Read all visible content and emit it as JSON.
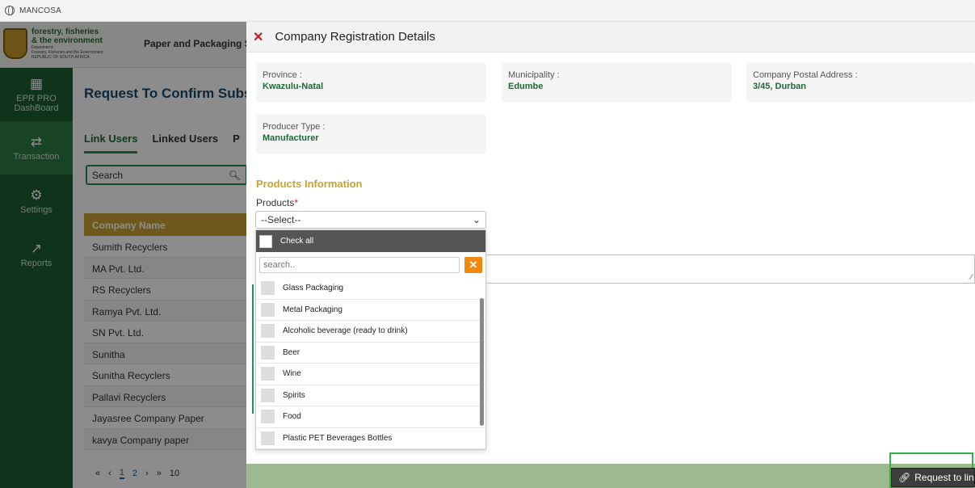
{
  "browser": {
    "title": "MANCOSA"
  },
  "app": {
    "logo_line1": "forestry, fisheries",
    "logo_line2": "& the environment",
    "logo_small1": "Department:",
    "logo_small2": "Forestry, Fisheries and the Environment",
    "logo_small3": "REPUBLIC OF SOUTH AFRICA",
    "header_title": "Paper and Packaging Sec",
    "page_title": "Request To Confirm Subscr",
    "nav": [
      {
        "label": "EPR PRO DashBoard",
        "icon": "dashboard-icon"
      },
      {
        "label": "Transaction",
        "icon": "transaction-icon"
      },
      {
        "label": "Settings",
        "icon": "settings-icon"
      },
      {
        "label": "Reports",
        "icon": "reports-icon"
      }
    ],
    "tabs": [
      "Link Users",
      "Linked Users",
      "P"
    ],
    "search_placeholder": "Search",
    "table_header": "Company Name",
    "rows": [
      "Sumith Recyclers",
      "MA Pvt. Ltd.",
      "RS Recyclers",
      "Ramya Pvt. Ltd.",
      "SN Pvt. Ltd.",
      "Sunitha",
      "Sunitha Recyclers",
      "Pallavi Recyclers",
      "Jayasree Company Paper",
      "kavya Company paper"
    ],
    "pager": {
      "p1": "1",
      "p2": "2",
      "size": "10"
    }
  },
  "modal": {
    "title": "Company Registration Details",
    "province_label": "Province :",
    "province_value": "Kwazulu-Natal",
    "municipality_label": "Municipality :",
    "municipality_value": "Edumbe",
    "postal_label": "Company Postal Address :",
    "postal_value": "3/45, Durban",
    "producer_label": "Producer Type :",
    "producer_value": "Manufacturer",
    "section_title": "Products Information",
    "products_label": "Products",
    "select_value": "--Select--",
    "check_all": "Check all",
    "dd_search_placeholder": "search..",
    "options": [
      "Glass Packaging",
      "Metal Packaging",
      "Alcoholic beverage (ready to drink)",
      "Beer",
      "Wine",
      "Spirits",
      "Food",
      "Plastic PET Beverages Bottles"
    ],
    "request_button": "Request to lin"
  }
}
